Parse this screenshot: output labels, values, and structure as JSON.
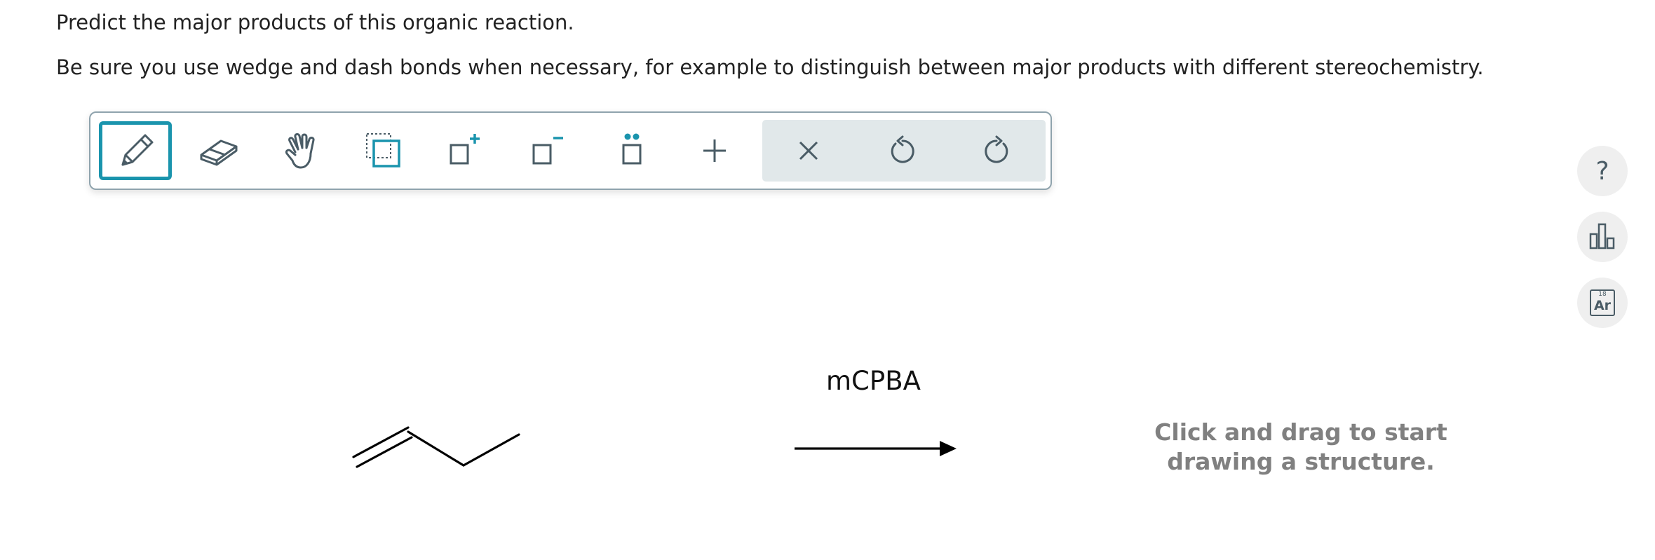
{
  "question": {
    "line1": "Predict the major products of this organic reaction.",
    "line2": "Be sure you use wedge and dash bonds when necessary, for example to distinguish between major products with different stereochemistry."
  },
  "toolbar": {
    "tools": [
      {
        "name": "pencil",
        "icon": "pencil-icon",
        "active": true
      },
      {
        "name": "eraser",
        "icon": "eraser-icon"
      },
      {
        "name": "hand",
        "icon": "hand-icon"
      },
      {
        "name": "select",
        "icon": "select-icon"
      },
      {
        "name": "increase-charge",
        "icon": "add-charge-icon"
      },
      {
        "name": "decrease-charge",
        "icon": "remove-charge-icon"
      },
      {
        "name": "lone-pair",
        "icon": "lone-pair-icon"
      },
      {
        "name": "add-plus",
        "icon": "plus-icon"
      }
    ],
    "actions": [
      {
        "name": "clear",
        "icon": "close-icon"
      },
      {
        "name": "undo",
        "icon": "undo-icon"
      },
      {
        "name": "redo",
        "icon": "redo-icon"
      }
    ],
    "accent_color": "#1a94ad",
    "icon_color": "#4a5c66"
  },
  "sidebar": {
    "help_glyph": "?",
    "stats_icon": "bar-chart-icon",
    "periodic": {
      "number": "18",
      "symbol": "Ar"
    }
  },
  "reaction": {
    "reactant": "1-butene skeletal structure",
    "reagent": "mCPBA",
    "arrow": "reaction-arrow"
  },
  "product_area": {
    "line1": "Click and drag to start",
    "line2": "drawing a structure."
  }
}
